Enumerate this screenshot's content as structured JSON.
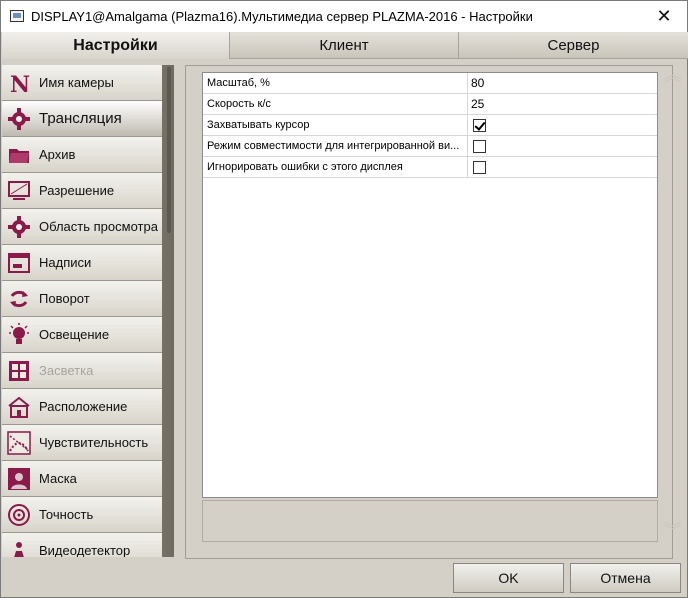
{
  "window": {
    "title": "DISPLAY1@Amalgama (Plazma16).Мультимедиа сервер PLAZMA-2016 - Настройки",
    "close_glyph": "✕"
  },
  "tabs": [
    {
      "label": "Настройки",
      "active": true
    },
    {
      "label": "Клиент",
      "active": false
    },
    {
      "label": "Сервер",
      "active": false
    }
  ],
  "sidebar": {
    "items": [
      {
        "label": "Имя камеры",
        "icon": "n-letter-icon"
      },
      {
        "label": "Трансляция",
        "icon": "gear-icon",
        "selected": true
      },
      {
        "label": "Архив",
        "icon": "folder-icon"
      },
      {
        "label": "Разрешение",
        "icon": "monitor-icon"
      },
      {
        "label": "Область просмотра",
        "icon": "gear-icon"
      },
      {
        "label": "Надписи",
        "icon": "caption-icon"
      },
      {
        "label": "Поворот",
        "icon": "rotate-icon"
      },
      {
        "label": "Освещение",
        "icon": "lightbulb-icon"
      },
      {
        "label": "Засветка",
        "icon": "window-icon",
        "disabled": true
      },
      {
        "label": "Расположение",
        "icon": "house-icon"
      },
      {
        "label": "Чувствительность",
        "icon": "sensitivity-icon"
      },
      {
        "label": "Маска",
        "icon": "mask-icon"
      },
      {
        "label": "Точность",
        "icon": "target-icon"
      },
      {
        "label": "Видеодетектор",
        "icon": "detector-icon"
      }
    ]
  },
  "properties": [
    {
      "name": "Масштаб, %",
      "type": "text",
      "value": "80"
    },
    {
      "name": "Скорость к/с",
      "type": "text",
      "value": "25"
    },
    {
      "name": "Захватывать курсор",
      "type": "checkbox",
      "checked": true
    },
    {
      "name": "Режим совместимости для интегрированной ви...",
      "type": "checkbox",
      "checked": false
    },
    {
      "name": "Игнорировать ошибки с этого дисплея",
      "type": "checkbox",
      "checked": false
    }
  ],
  "buttons": {
    "ok": "OK",
    "cancel": "Отмена"
  },
  "colors": {
    "accent": "#8a1a4a",
    "chrome": "#d4d0c8"
  }
}
